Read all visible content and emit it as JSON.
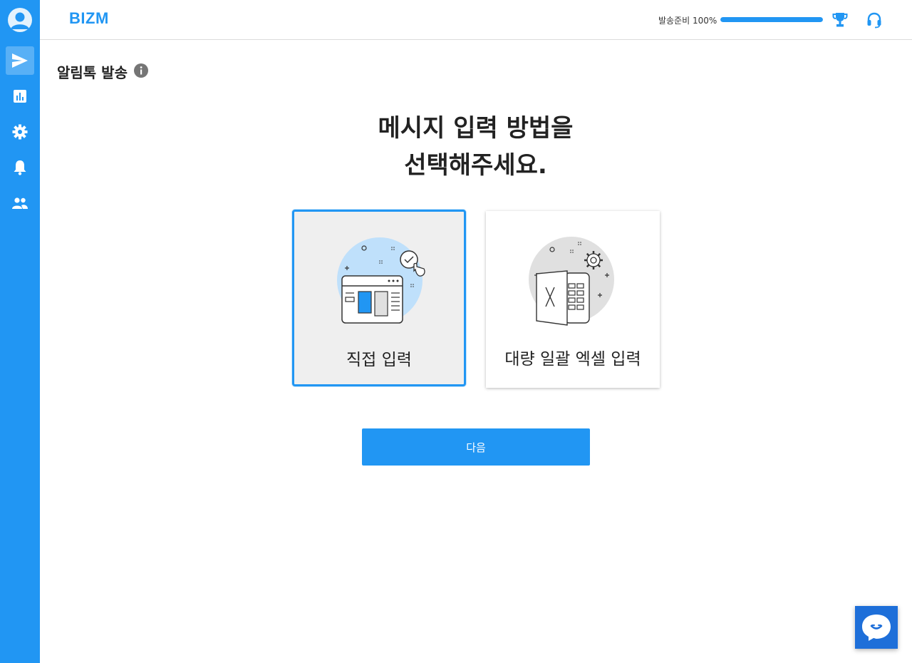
{
  "app": {
    "logo_text": "BIZM",
    "accent": "#2196f3"
  },
  "header": {
    "progress_label": "발송준비 100%",
    "progress_value": 1.0,
    "icons": [
      "trophy-icon",
      "headset-icon"
    ]
  },
  "sidebar": {
    "items": [
      {
        "name": "send",
        "icon": "send-icon",
        "active": true
      },
      {
        "name": "stats",
        "icon": "bar-chart-icon",
        "active": false
      },
      {
        "name": "settings",
        "icon": "gear-icon",
        "active": false
      },
      {
        "name": "notifications",
        "icon": "bell-icon",
        "active": false
      },
      {
        "name": "users",
        "icon": "people-icon",
        "active": false
      }
    ]
  },
  "page": {
    "title": "알림톡 발송",
    "heading_line1": "메시지 입력 방법을",
    "heading_line2": "선택해주세요."
  },
  "options": [
    {
      "label": "직접 입력",
      "selected": true,
      "icon": "form-window-icon"
    },
    {
      "label": "대량 일괄 엑셀 입력",
      "selected": false,
      "icon": "excel-file-icon"
    }
  ],
  "actions": {
    "next_label": "다음"
  },
  "chat": {
    "icon": "chat-bubble-icon"
  }
}
